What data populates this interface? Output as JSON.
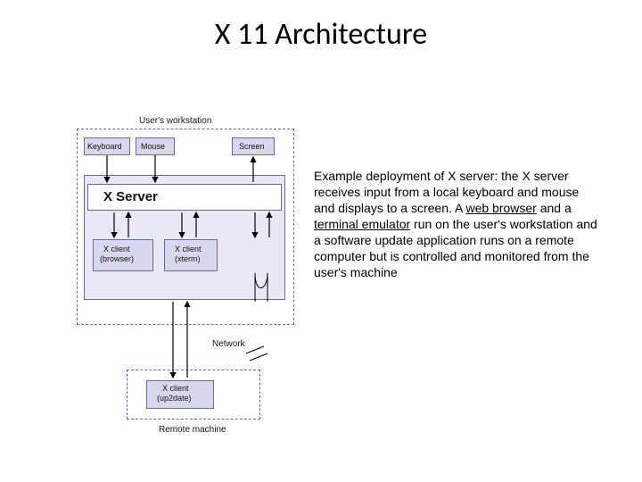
{
  "title": "X 11 Architecture",
  "diagram": {
    "caption_top": "User's workstation",
    "keyboard": "Keyboard",
    "mouse": "Mouse",
    "screen": "Screen",
    "xserver": "X Server",
    "client_browser_l1": "X client",
    "client_browser_l2": "(browser)",
    "client_xterm_l1": "X client",
    "client_xterm_l2": "(xterm)",
    "network": "Network",
    "client_remote_l1": "X client",
    "client_remote_l2": "(up2date)",
    "caption_bottom": "Remote machine"
  },
  "description": {
    "t1": "Example deployment of X server: the X server receives input from a local keyboard and mouse and displays to a screen. A ",
    "link1": "web browser",
    "t2": " and a ",
    "link2": "terminal emulator",
    "t3": " run on the user's workstation and a software update application runs on a remote computer but is controlled and monitored from the user's machine"
  }
}
